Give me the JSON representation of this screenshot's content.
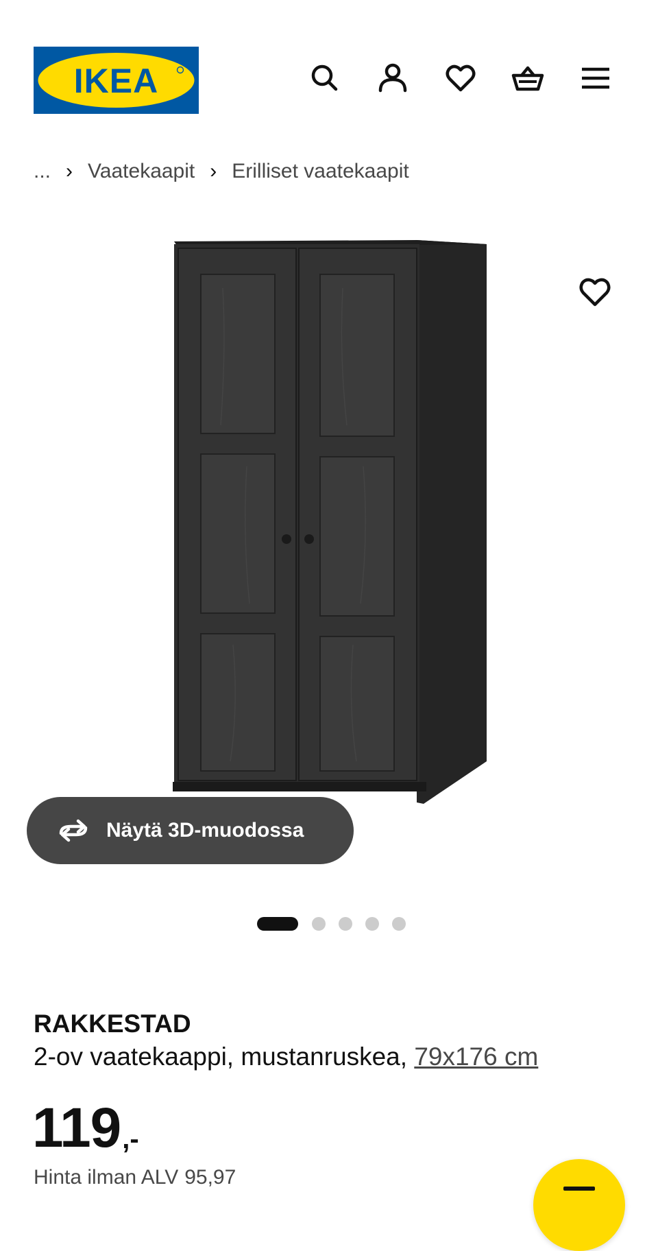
{
  "header": {
    "logo_text": "IKEA",
    "logo_colors": {
      "blue": "#0058a3",
      "yellow": "#ffdb00"
    },
    "icons": [
      "search-icon",
      "user-icon",
      "heart-icon",
      "basket-icon",
      "menu-icon"
    ]
  },
  "breadcrumb": {
    "ellipsis": "...",
    "separator": "›",
    "items": [
      "Vaatekaapit",
      "Erilliset vaatekaapit"
    ]
  },
  "gallery": {
    "view_3d_label": "Näytä 3D-muodossa",
    "image_count": 5,
    "active_index": 0
  },
  "product": {
    "name": "RAKKESTAD",
    "description": "2-ov vaatekaappi, mustanruskea,",
    "size_link": "79x176 cm",
    "price_main": "119",
    "price_suffix": ",-",
    "vat_label": "Hinta ilman ALV",
    "vat_value": "95,97"
  },
  "colors": {
    "accent_yellow": "#ffdb00",
    "text_dark": "#111111",
    "text_gray": "#484848"
  }
}
